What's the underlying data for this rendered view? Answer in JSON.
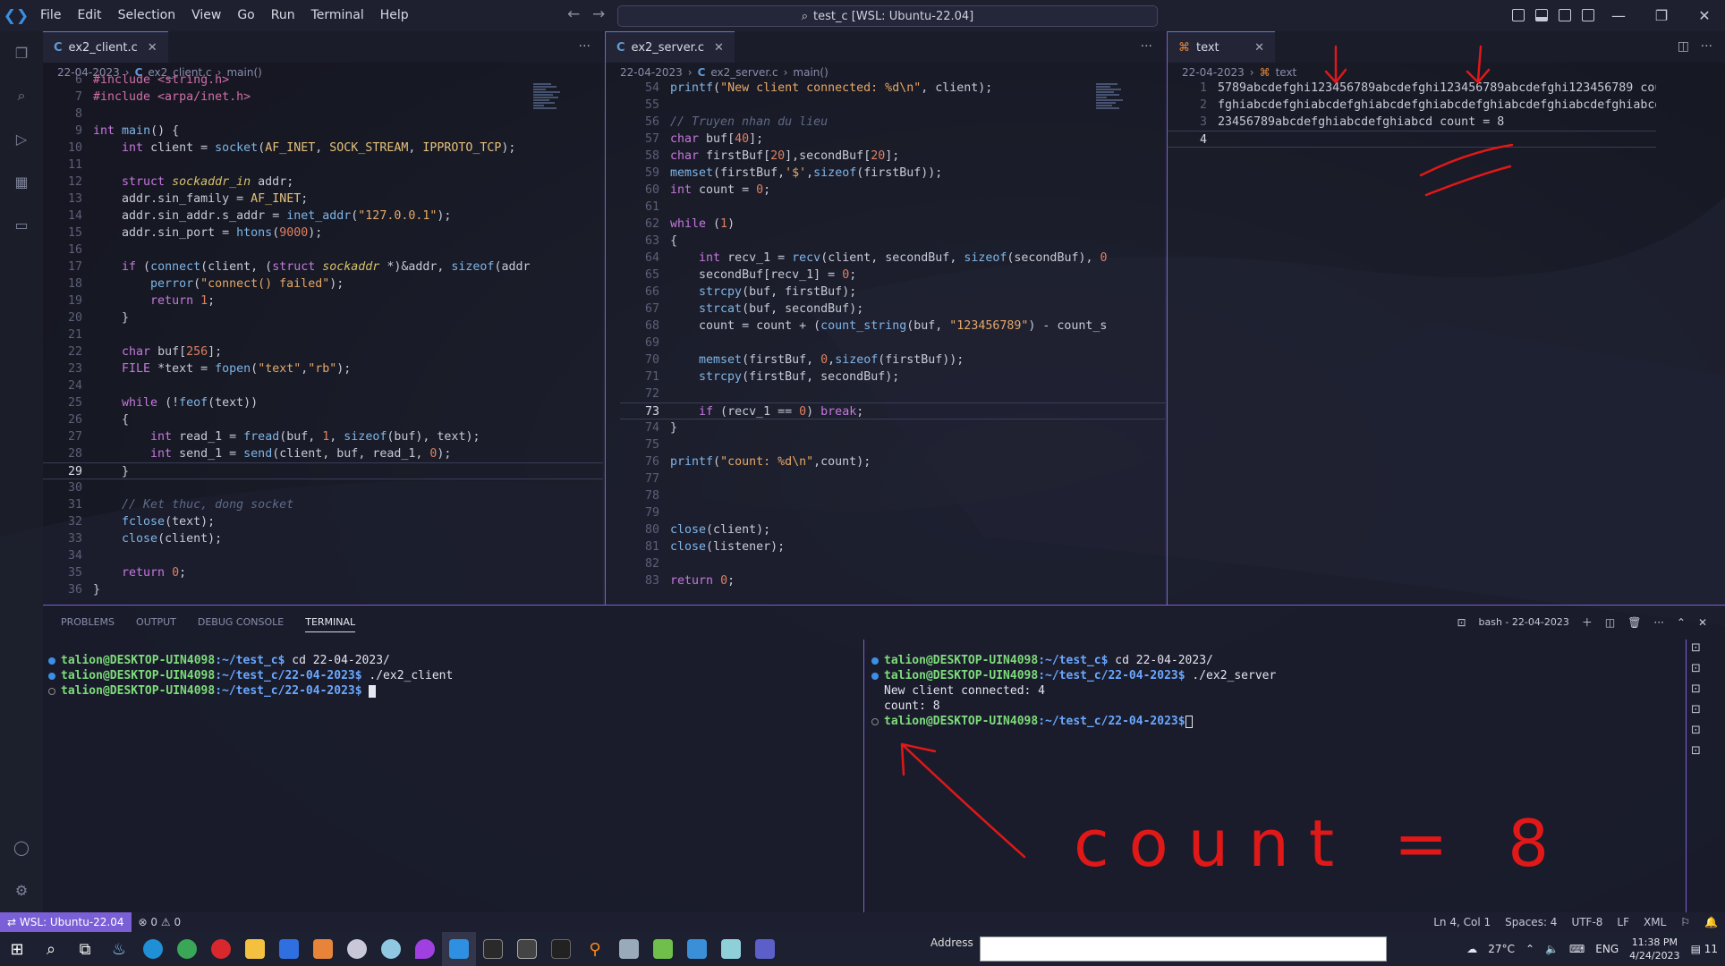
{
  "menubar": {
    "items": [
      "File",
      "Edit",
      "Selection",
      "View",
      "Go",
      "Run",
      "Terminal",
      "Help"
    ],
    "command_center": "test_c [WSL: Ubuntu-22.04]"
  },
  "editors": {
    "client": {
      "tab_lang": "C",
      "tab_label": "ex2_client.c",
      "breadcrumb": [
        "22-04-2023",
        "ex2_client.c",
        "main()"
      ],
      "lines": [
        {
          "n": "6",
          "t": "#include <string.h>"
        },
        {
          "n": "7",
          "t": "#include <arpa/inet.h>"
        },
        {
          "n": "8",
          "t": ""
        },
        {
          "n": "9",
          "t": "int main() {"
        },
        {
          "n": "10",
          "t": "    int client = socket(AF_INET, SOCK_STREAM, IPPROTO_TCP);"
        },
        {
          "n": "11",
          "t": ""
        },
        {
          "n": "12",
          "t": "    struct sockaddr_in addr;"
        },
        {
          "n": "13",
          "t": "    addr.sin_family = AF_INET;"
        },
        {
          "n": "14",
          "t": "    addr.sin_addr.s_addr = inet_addr(\"127.0.0.1\");"
        },
        {
          "n": "15",
          "t": "    addr.sin_port = htons(9000);"
        },
        {
          "n": "16",
          "t": ""
        },
        {
          "n": "17",
          "t": "    if (connect(client, (struct sockaddr *)&addr, sizeof(addr"
        },
        {
          "n": "18",
          "t": "        perror(\"connect() failed\");"
        },
        {
          "n": "19",
          "t": "        return 1;"
        },
        {
          "n": "20",
          "t": "    }"
        },
        {
          "n": "21",
          "t": ""
        },
        {
          "n": "22",
          "t": "    char buf[256];"
        },
        {
          "n": "23",
          "t": "    FILE *text = fopen(\"text\",\"rb\");"
        },
        {
          "n": "24",
          "t": ""
        },
        {
          "n": "25",
          "t": "    while (!feof(text))"
        },
        {
          "n": "26",
          "t": "    {"
        },
        {
          "n": "27",
          "t": "        int read_1 = fread(buf, 1, sizeof(buf), text);"
        },
        {
          "n": "28",
          "t": "        int send_1 = send(client, buf, read_1, 0);"
        },
        {
          "n": "29",
          "t": "    }"
        },
        {
          "n": "30",
          "t": ""
        },
        {
          "n": "31",
          "t": "    // Ket thuc, dong socket"
        },
        {
          "n": "32",
          "t": "    fclose(text);"
        },
        {
          "n": "33",
          "t": "    close(client);"
        },
        {
          "n": "34",
          "t": ""
        },
        {
          "n": "35",
          "t": "    return 0;"
        },
        {
          "n": "36",
          "t": "}"
        }
      ],
      "active_line": "29"
    },
    "server": {
      "tab_lang": "C",
      "tab_label": "ex2_server.c",
      "breadcrumb": [
        "22-04-2023",
        "ex2_server.c",
        "main()"
      ],
      "lines": [
        {
          "n": "54",
          "t": "printf(\"New client connected: %d\\n\", client);"
        },
        {
          "n": "55",
          "t": ""
        },
        {
          "n": "56",
          "t": "// Truyen nhan du lieu"
        },
        {
          "n": "57",
          "t": "char buf[40];"
        },
        {
          "n": "58",
          "t": "char firstBuf[20],secondBuf[20];"
        },
        {
          "n": "59",
          "t": "memset(firstBuf,'$',sizeof(firstBuf));"
        },
        {
          "n": "60",
          "t": "int count = 0;"
        },
        {
          "n": "61",
          "t": ""
        },
        {
          "n": "62",
          "t": "while (1)"
        },
        {
          "n": "63",
          "t": "{"
        },
        {
          "n": "64",
          "t": "    int recv_1 = recv(client, secondBuf, sizeof(secondBuf), 0"
        },
        {
          "n": "65",
          "t": "    secondBuf[recv_1] = 0;"
        },
        {
          "n": "66",
          "t": "    strcpy(buf, firstBuf);"
        },
        {
          "n": "67",
          "t": "    strcat(buf, secondBuf);"
        },
        {
          "n": "68",
          "t": "    count = count + (count_string(buf, \"123456789\") - count_s"
        },
        {
          "n": "69",
          "t": ""
        },
        {
          "n": "70",
          "t": "    memset(firstBuf, 0,sizeof(firstBuf));"
        },
        {
          "n": "71",
          "t": "    strcpy(firstBuf, secondBuf);"
        },
        {
          "n": "72",
          "t": ""
        },
        {
          "n": "73",
          "t": "    if (recv_1 == 0) break;"
        },
        {
          "n": "74",
          "t": "}"
        },
        {
          "n": "75",
          "t": ""
        },
        {
          "n": "76",
          "t": "printf(\"count: %d\\n\",count);"
        },
        {
          "n": "77",
          "t": ""
        },
        {
          "n": "78",
          "t": ""
        },
        {
          "n": "79",
          "t": ""
        },
        {
          "n": "80",
          "t": "close(client);"
        },
        {
          "n": "81",
          "t": "close(listener);"
        },
        {
          "n": "82",
          "t": ""
        },
        {
          "n": "83",
          "t": "return 0;"
        }
      ],
      "active_line": "73"
    },
    "text": {
      "tab_label": "text",
      "breadcrumb": [
        "22-04-2023",
        "text"
      ],
      "lines": [
        {
          "n": "1",
          "t": "5789abcdefghi123456789abcdefghi123456789abcdefghi123456789 cou"
        },
        {
          "n": "2",
          "t": "fghiabcdefghiabcdefghiabcdefghiabcdefghiabcdefghiabcdefghiabcd"
        },
        {
          "n": "3",
          "t": "23456789abcdefghiabcdefghiabcd count = 8"
        },
        {
          "n": "4",
          "t": ""
        }
      ],
      "active_line": "4"
    }
  },
  "panel": {
    "tabs": [
      "PROBLEMS",
      "OUTPUT",
      "DEBUG CONSOLE",
      "TERMINAL"
    ],
    "active_tab": "TERMINAL",
    "terminal_name": "bash - 22-04-2023",
    "left_terminal": [
      {
        "user": "talion@DESKTOP-UIN4098",
        "path": ":~/test_c$",
        "cmd": " cd 22-04-2023/"
      },
      {
        "user": "talion@DESKTOP-UIN4098",
        "path": ":~/test_c/22-04-2023$",
        "cmd": " ./ex2_client"
      },
      {
        "user": "talion@DESKTOP-UIN4098",
        "path": ":~/test_c/22-04-2023$",
        "cmd": " "
      }
    ],
    "right_terminal": [
      {
        "user": "talion@DESKTOP-UIN4098",
        "path": ":~/test_c$",
        "cmd": " cd 22-04-2023/"
      },
      {
        "user": "talion@DESKTOP-UIN4098",
        "path": ":~/test_c/22-04-2023$",
        "cmd": " ./ex2_server"
      }
    ],
    "right_output": [
      "New client connected: 4",
      "count: 8"
    ],
    "right_prompt": {
      "user": "talion@DESKTOP-UIN4098",
      "path": ":~/test_c/22-04-2023$"
    }
  },
  "annotation_text": "count = 8",
  "statusbar": {
    "remote": "WSL: Ubuntu-22.04",
    "problems": "0",
    "warnings": "0",
    "position": "Ln 4, Col 1",
    "spaces": "Spaces: 4",
    "encoding": "UTF-8",
    "eol": "LF",
    "language": "XML"
  },
  "taskbar": {
    "address_label": "Address",
    "weather": "27°C",
    "lang": "ENG",
    "time": "11:38 PM",
    "date": "4/24/2023",
    "notifications": "11"
  },
  "colors": {
    "accent": "#7b5fd6",
    "annotation": "#e01818",
    "prompt_user": "#7ddc7a",
    "prompt_path": "#6aa8ff"
  }
}
